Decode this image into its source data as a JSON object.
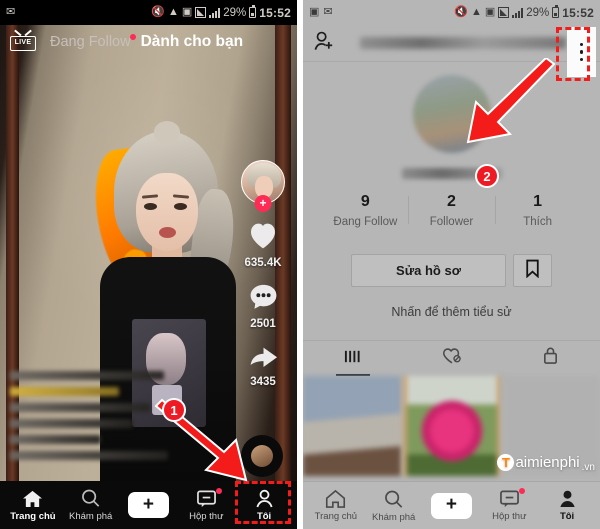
{
  "status_bar": {
    "battery_percent": "29%",
    "time": "15:52",
    "icons_left_feed": [
      "mail-icon"
    ],
    "icons_left_profile": [
      "screenshot-icon",
      "mail-icon"
    ],
    "icons_right": [
      "mute-icon",
      "wifi-icon",
      "nfc-icon",
      "signal-box-icon",
      "signal-bars-icon"
    ]
  },
  "left_panel": {
    "name": "tiktok-feed-screen",
    "header": {
      "live_label": "LIVE",
      "tabs": [
        {
          "label": "Đang Follow",
          "active": false,
          "has_dot": true
        },
        {
          "label": "Dành cho bạn",
          "active": true,
          "has_dot": false
        }
      ]
    },
    "action_rail": {
      "avatar_name": "creator-avatar",
      "follow_plus": "+",
      "like_count": "635.4K",
      "comment_count": "2501",
      "share_count": "3435"
    },
    "caption": "(blurred caption text)",
    "music_disc": "music-disc-icon"
  },
  "right_panel": {
    "name": "tiktok-profile-screen",
    "header": {
      "add_friend_icon": "add-person-icon",
      "username": "(blurred username)",
      "menu_icon": "three-dot-menu-icon"
    },
    "avatar": "(blurred profile photo)",
    "display_name": "(blurred display name)",
    "stats": [
      {
        "value": "9",
        "label": "Đang Follow"
      },
      {
        "value": "2",
        "label": "Follower"
      },
      {
        "value": "1",
        "label": "Thích"
      }
    ],
    "edit_profile_label": "Sửa hồ sơ",
    "bookmark_icon": "bookmark-icon",
    "bio_placeholder": "Nhấn để thêm tiểu sử",
    "content_tabs": [
      {
        "icon": "grid-icon",
        "active": true
      },
      {
        "icon": "heart-hidden-icon",
        "active": false
      },
      {
        "icon": "lock-icon",
        "active": false
      }
    ],
    "grid_items": [
      "(blurred video thumbnail)",
      "(blurred video thumbnail)"
    ]
  },
  "bottom_nav": [
    {
      "label": "Trang chủ",
      "icon": "home-icon"
    },
    {
      "label": "Khám phá",
      "icon": "search-icon"
    },
    {
      "label": "",
      "icon": "create-plus-button"
    },
    {
      "label": "Hộp thư",
      "icon": "inbox-icon",
      "has_dot": true
    },
    {
      "label": "Tôi",
      "icon": "profile-person-icon"
    }
  ],
  "annotations": [
    {
      "badge": "1",
      "target": "Tôi tab in left feed bottom nav"
    },
    {
      "badge": "2",
      "target": "three-dot menu in profile header"
    }
  ],
  "watermark": {
    "mark": "T",
    "text": "aimienphi",
    "domain": ".vn"
  },
  "colors": {
    "accent_red": "#fe2c55",
    "annotation_red": "#ee1b24",
    "cyan": "#29e8ec"
  }
}
